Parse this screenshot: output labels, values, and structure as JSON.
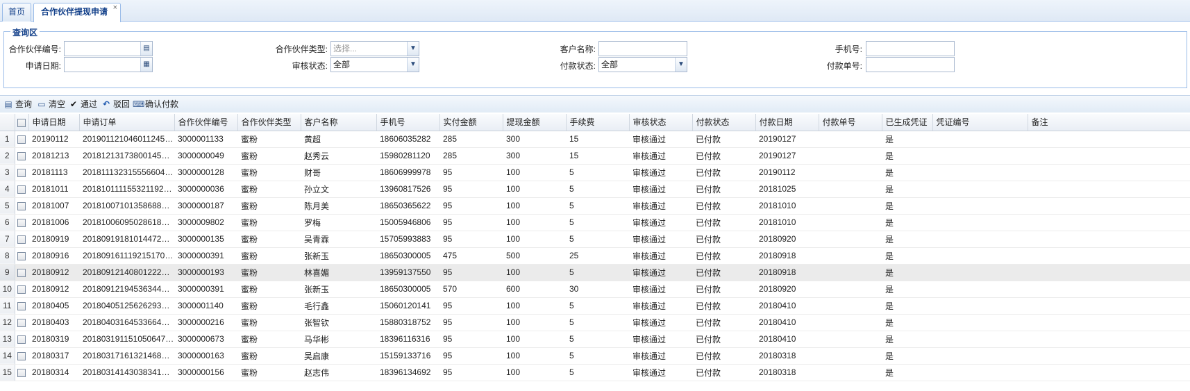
{
  "tabs": {
    "home": "首页",
    "active": "合作伙伴提现申请",
    "close": "×"
  },
  "query": {
    "title": "查询区",
    "fields": {
      "partner_no": {
        "label": "合作伙伴编号:",
        "value": ""
      },
      "partner_type": {
        "label": "合作伙伴类型:",
        "placeholder": "选择..."
      },
      "customer_name": {
        "label": "客户名称:",
        "value": ""
      },
      "phone": {
        "label": "手机号:",
        "value": ""
      },
      "apply_date": {
        "label": "申请日期:",
        "value": ""
      },
      "audit_status": {
        "label": "审核状态:",
        "value": "全部"
      },
      "pay_status": {
        "label": "付款状态:",
        "value": "全部"
      },
      "pay_no": {
        "label": "付款单号:",
        "value": ""
      }
    }
  },
  "toolbar": {
    "query": "查询",
    "clear": "清空",
    "approve": "通过",
    "reject": "驳回",
    "confirm_pay": "确认付款"
  },
  "grid": {
    "columns": [
      "申请日期",
      "申请订单",
      "合作伙伴编号",
      "合作伙伴类型",
      "客户名称",
      "手机号",
      "实付金额",
      "提现金额",
      "手续费",
      "审核状态",
      "付款状态",
      "付款日期",
      "付款单号",
      "已生成凭证",
      "凭证编号",
      "备注"
    ],
    "selected_row": 9,
    "rows": [
      {
        "n": "1",
        "date": "20190112",
        "order": "2019011210460112452…",
        "pno": "3000001133",
        "ptype": "蜜粉",
        "cname": "黄超",
        "phone": "18606035282",
        "paid": "285",
        "amount": "300",
        "fee": "15",
        "audit": "审核通过",
        "pstatus": "已付款",
        "pdate": "20190127",
        "payno": "",
        "voucher": "是",
        "vno": "",
        "remark": ""
      },
      {
        "n": "2",
        "date": "20181213",
        "order": "2018121317380014594…",
        "pno": "3000000049",
        "ptype": "蜜粉",
        "cname": "赵秀云",
        "phone": "15980281120",
        "paid": "285",
        "amount": "300",
        "fee": "15",
        "audit": "审核通过",
        "pstatus": "已付款",
        "pdate": "20190127",
        "payno": "",
        "voucher": "是",
        "vno": "",
        "remark": ""
      },
      {
        "n": "3",
        "date": "20181113",
        "order": "2018111323155566046…",
        "pno": "3000000128",
        "ptype": "蜜粉",
        "cname": "财哥",
        "phone": "18606999978",
        "paid": "95",
        "amount": "100",
        "fee": "5",
        "audit": "审核通过",
        "pstatus": "已付款",
        "pdate": "20190112",
        "payno": "",
        "voucher": "是",
        "vno": "",
        "remark": ""
      },
      {
        "n": "4",
        "date": "20181011",
        "order": "2018101111553211920…",
        "pno": "3000000036",
        "ptype": "蜜粉",
        "cname": "孙立文",
        "phone": "13960817526",
        "paid": "95",
        "amount": "100",
        "fee": "5",
        "audit": "审核通过",
        "pstatus": "已付款",
        "pdate": "20181025",
        "payno": "",
        "voucher": "是",
        "vno": "",
        "remark": ""
      },
      {
        "n": "5",
        "date": "20181007",
        "order": "2018100710135868801…",
        "pno": "3000000187",
        "ptype": "蜜粉",
        "cname": "陈月美",
        "phone": "18650365622",
        "paid": "95",
        "amount": "100",
        "fee": "5",
        "audit": "审核通过",
        "pstatus": "已付款",
        "pdate": "20181010",
        "payno": "",
        "voucher": "是",
        "vno": "",
        "remark": ""
      },
      {
        "n": "6",
        "date": "20181006",
        "order": "2018100609502861801…",
        "pno": "3000009802",
        "ptype": "蜜粉",
        "cname": "罗梅",
        "phone": "15005946806",
        "paid": "95",
        "amount": "100",
        "fee": "5",
        "audit": "审核通过",
        "pstatus": "已付款",
        "pdate": "20181010",
        "payno": "",
        "voucher": "是",
        "vno": "",
        "remark": ""
      },
      {
        "n": "7",
        "date": "20180919",
        "order": "2018091918101447207…",
        "pno": "3000000135",
        "ptype": "蜜粉",
        "cname": "吴青霖",
        "phone": "15705993883",
        "paid": "95",
        "amount": "100",
        "fee": "5",
        "audit": "审核通过",
        "pstatus": "已付款",
        "pdate": "20180920",
        "payno": "",
        "voucher": "是",
        "vno": "",
        "remark": ""
      },
      {
        "n": "8",
        "date": "20180916",
        "order": "2018091611192151701…",
        "pno": "3000000391",
        "ptype": "蜜粉",
        "cname": "张新玉",
        "phone": "18650300005",
        "paid": "475",
        "amount": "500",
        "fee": "25",
        "audit": "审核通过",
        "pstatus": "已付款",
        "pdate": "20180918",
        "payno": "",
        "voucher": "是",
        "vno": "",
        "remark": ""
      },
      {
        "n": "9",
        "date": "20180912",
        "order": "2018091214080122247…",
        "pno": "3000000193",
        "ptype": "蜜粉",
        "cname": "林喜媚",
        "phone": "13959137550",
        "paid": "95",
        "amount": "100",
        "fee": "5",
        "audit": "审核通过",
        "pstatus": "已付款",
        "pdate": "20180918",
        "payno": "",
        "voucher": "是",
        "vno": "",
        "remark": ""
      },
      {
        "n": "10",
        "date": "20180912",
        "order": "2018091219453634424…",
        "pno": "3000000391",
        "ptype": "蜜粉",
        "cname": "张新玉",
        "phone": "18650300005",
        "paid": "570",
        "amount": "600",
        "fee": "30",
        "audit": "审核通过",
        "pstatus": "已付款",
        "pdate": "20180920",
        "payno": "",
        "voucher": "是",
        "vno": "",
        "remark": ""
      },
      {
        "n": "11",
        "date": "20180405",
        "order": "2018040512562629322…",
        "pno": "3000001140",
        "ptype": "蜜粉",
        "cname": "毛行鑫",
        "phone": "15060120141",
        "paid": "95",
        "amount": "100",
        "fee": "5",
        "audit": "审核通过",
        "pstatus": "已付款",
        "pdate": "20180410",
        "payno": "",
        "voucher": "是",
        "vno": "",
        "remark": ""
      },
      {
        "n": "12",
        "date": "20180403",
        "order": "2018040316453366406…",
        "pno": "3000000216",
        "ptype": "蜜粉",
        "cname": "张智钦",
        "phone": "15880318752",
        "paid": "95",
        "amount": "100",
        "fee": "5",
        "audit": "审核通过",
        "pstatus": "已付款",
        "pdate": "20180410",
        "payno": "",
        "voucher": "是",
        "vno": "",
        "remark": ""
      },
      {
        "n": "13",
        "date": "20180319",
        "order": "2018031911510506475…",
        "pno": "3000000673",
        "ptype": "蜜粉",
        "cname": "马华彬",
        "phone": "18396116316",
        "paid": "95",
        "amount": "100",
        "fee": "5",
        "audit": "审核通过",
        "pstatus": "已付款",
        "pdate": "20180410",
        "payno": "",
        "voucher": "是",
        "vno": "",
        "remark": ""
      },
      {
        "n": "14",
        "date": "20180317",
        "order": "2018031716132146888…",
        "pno": "3000000163",
        "ptype": "蜜粉",
        "cname": "吴启康",
        "phone": "15159133716",
        "paid": "95",
        "amount": "100",
        "fee": "5",
        "audit": "审核通过",
        "pstatus": "已付款",
        "pdate": "20180318",
        "payno": "",
        "voucher": "是",
        "vno": "",
        "remark": ""
      },
      {
        "n": "15",
        "date": "20180314",
        "order": "2018031414303834124…",
        "pno": "3000000156",
        "ptype": "蜜粉",
        "cname": "赵志伟",
        "phone": "18396134692",
        "paid": "95",
        "amount": "100",
        "fee": "5",
        "audit": "审核通过",
        "pstatus": "已付款",
        "pdate": "20180318",
        "payno": "",
        "voucher": "是",
        "vno": "",
        "remark": ""
      }
    ]
  }
}
